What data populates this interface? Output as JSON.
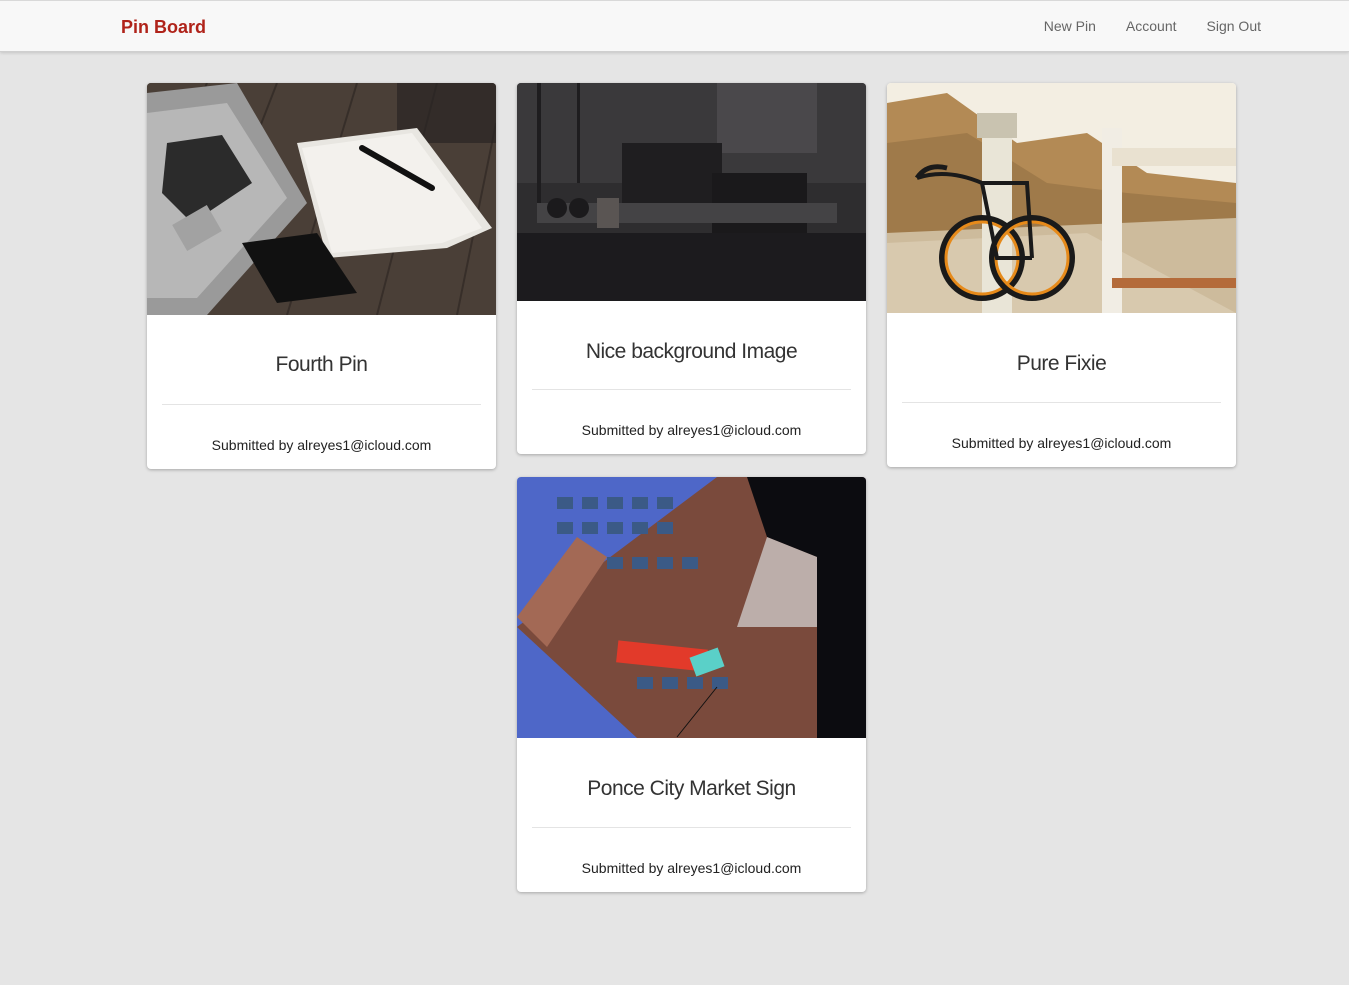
{
  "navbar": {
    "brand": "Pin Board",
    "links": [
      "New Pin",
      "Account",
      "Sign Out"
    ]
  },
  "colors": {
    "brand": "#b0231a",
    "background": "#e5e5e5",
    "card": "#ffffff"
  },
  "pins": [
    {
      "title": "Fourth Pin",
      "submitted": "Submitted by alreyes1@icloud.com",
      "image": "laptop-notebook-photo"
    },
    {
      "title": "Nice background Image",
      "submitted": "Submitted by alreyes1@icloud.com",
      "image": "dark-office-desk-photo"
    },
    {
      "title": "Pure Fixie",
      "submitted": "Submitted by alreyes1@icloud.com",
      "image": "fixie-bicycle-photo"
    },
    {
      "title": "Ponce City Market Sign",
      "submitted": "Submitted by alreyes1@icloud.com",
      "image": "building-sign-photo"
    }
  ]
}
